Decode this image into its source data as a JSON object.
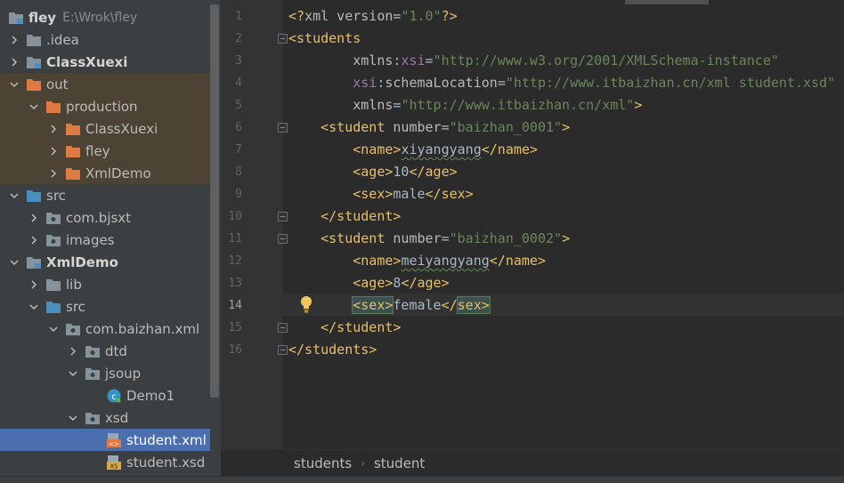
{
  "project_tree": {
    "rows": [
      {
        "label": "fley",
        "path": "E:\\Wrok\\fley",
        "level": 0,
        "arrow": "none",
        "icon": "module-folder",
        "bold": true
      },
      {
        "label": ".idea",
        "level": 0,
        "arrow": "right",
        "icon": "folder",
        "bold": false
      },
      {
        "label": "ClassXuexi",
        "level": 0,
        "arrow": "right",
        "icon": "module-folder",
        "bold": true
      },
      {
        "label": "out",
        "level": 0,
        "arrow": "down",
        "icon": "excluded-folder",
        "excluded": true
      },
      {
        "label": "production",
        "level": 1,
        "arrow": "down",
        "icon": "excluded-folder",
        "excluded": true
      },
      {
        "label": "ClassXuexi",
        "level": 2,
        "arrow": "right",
        "icon": "excluded-folder",
        "excluded": true
      },
      {
        "label": "fley",
        "level": 2,
        "arrow": "right",
        "icon": "excluded-folder",
        "excluded": true
      },
      {
        "label": "XmlDemo",
        "level": 2,
        "arrow": "right",
        "icon": "excluded-folder",
        "excluded": true
      },
      {
        "label": "src",
        "level": 0,
        "arrow": "down",
        "icon": "source-folder"
      },
      {
        "label": "com.bjsxt",
        "level": 1,
        "arrow": "right",
        "icon": "package"
      },
      {
        "label": "images",
        "level": 1,
        "arrow": "right",
        "icon": "package"
      },
      {
        "label": "XmlDemo",
        "level": 0,
        "arrow": "down",
        "icon": "module-folder",
        "bold": true
      },
      {
        "label": "lib",
        "level": 1,
        "arrow": "right",
        "icon": "folder"
      },
      {
        "label": "src",
        "level": 1,
        "arrow": "down",
        "icon": "source-folder"
      },
      {
        "label": "com.baizhan.xml",
        "level": 2,
        "arrow": "down",
        "icon": "package"
      },
      {
        "label": "dtd",
        "level": 3,
        "arrow": "right",
        "icon": "package"
      },
      {
        "label": "jsoup",
        "level": 3,
        "arrow": "down",
        "icon": "package"
      },
      {
        "label": "Demo1",
        "level": 5,
        "arrow": "none",
        "icon": "java-class"
      },
      {
        "label": "xsd",
        "level": 3,
        "arrow": "down",
        "icon": "package"
      },
      {
        "label": "student.xml",
        "level": 5,
        "arrow": "none",
        "icon": "xml-file",
        "selected": true
      },
      {
        "label": "student.xsd",
        "level": 5,
        "arrow": "none",
        "icon": "xsd-file"
      }
    ]
  },
  "editor": {
    "current_line": 14,
    "lines": [
      {
        "n": "1",
        "tokens": [
          [
            "tag",
            "<?"
          ],
          [
            "attr",
            "xml version"
          ],
          [
            "txt",
            "="
          ],
          [
            "val",
            "\"1.0\""
          ],
          [
            "tag",
            "?>"
          ]
        ]
      },
      {
        "n": "2",
        "fold": true,
        "tokens": [
          [
            "tag",
            "<students"
          ]
        ]
      },
      {
        "n": "3",
        "tokens": [
          [
            "txt",
            "        "
          ],
          [
            "attr",
            "xmlns"
          ],
          [
            "txt",
            ":"
          ],
          [
            "nsp",
            "xsi"
          ],
          [
            "txt",
            "="
          ],
          [
            "val",
            "\"http://www.w3.org/2001/XMLSchema-instance\""
          ]
        ]
      },
      {
        "n": "4",
        "tokens": [
          [
            "txt",
            "        "
          ],
          [
            "nsp",
            "xsi"
          ],
          [
            "txt",
            ":"
          ],
          [
            "attr",
            "schemaLocation"
          ],
          [
            "txt",
            "="
          ],
          [
            "val",
            "\"http://www.itbaizhan.cn/xml student.xsd\""
          ]
        ]
      },
      {
        "n": "5",
        "tokens": [
          [
            "txt",
            "        "
          ],
          [
            "attr",
            "xmlns"
          ],
          [
            "txt",
            "="
          ],
          [
            "val",
            "\"http://www.itbaizhan.cn/xml\""
          ],
          [
            "tag",
            ">"
          ]
        ]
      },
      {
        "n": "6",
        "fold": true,
        "tokens": [
          [
            "txt",
            "    "
          ],
          [
            "tag",
            "<student "
          ],
          [
            "attr",
            "number"
          ],
          [
            "txt",
            "="
          ],
          [
            "val",
            "\"baizhan_0001\""
          ],
          [
            "tag",
            ">"
          ]
        ]
      },
      {
        "n": "7",
        "tokens": [
          [
            "txt",
            "        "
          ],
          [
            "tag",
            "<name>"
          ],
          [
            "txt squig",
            "xiyangyang"
          ],
          [
            "tag",
            "</name>"
          ]
        ]
      },
      {
        "n": "8",
        "tokens": [
          [
            "txt",
            "        "
          ],
          [
            "tag",
            "<age>"
          ],
          [
            "txt",
            "10"
          ],
          [
            "tag",
            "</age>"
          ]
        ]
      },
      {
        "n": "9",
        "tokens": [
          [
            "txt",
            "        "
          ],
          [
            "tag",
            "<sex>"
          ],
          [
            "txt",
            "male"
          ],
          [
            "tag",
            "</sex>"
          ]
        ]
      },
      {
        "n": "10",
        "fold": true,
        "tokens": [
          [
            "txt",
            "    "
          ],
          [
            "tag",
            "</student>"
          ]
        ]
      },
      {
        "n": "11",
        "fold": true,
        "tokens": [
          [
            "txt",
            "    "
          ],
          [
            "tag",
            "<student "
          ],
          [
            "attr",
            "number"
          ],
          [
            "txt",
            "="
          ],
          [
            "val",
            "\"baizhan_0002\""
          ],
          [
            "tag",
            ">"
          ]
        ]
      },
      {
        "n": "12",
        "tokens": [
          [
            "txt",
            "        "
          ],
          [
            "tag",
            "<name>"
          ],
          [
            "txt squig",
            "meiyangyang"
          ],
          [
            "tag",
            "</name>"
          ]
        ]
      },
      {
        "n": "13",
        "tokens": [
          [
            "txt",
            "        "
          ],
          [
            "tag",
            "<age>"
          ],
          [
            "txt",
            "8"
          ],
          [
            "tag",
            "</age>"
          ]
        ]
      },
      {
        "n": "14",
        "tokens": [
          [
            "txt",
            "        "
          ],
          [
            "tag hl",
            "<sex>"
          ],
          [
            "txt",
            "female"
          ],
          [
            "tag",
            "</"
          ],
          [
            "tag hl",
            "sex>"
          ]
        ]
      },
      {
        "n": "15",
        "fold": true,
        "tokens": [
          [
            "txt",
            "    "
          ],
          [
            "tag",
            "</student>"
          ]
        ]
      },
      {
        "n": "16",
        "fold": true,
        "tokens": [
          [
            "tag",
            "</students>"
          ]
        ]
      }
    ]
  },
  "breadcrumbs": [
    "students",
    "student"
  ],
  "colors": {
    "tag": "#e8bf6a",
    "attribute": "#bababa",
    "namespace": "#9876aa",
    "string": "#6a8759",
    "text": "#a9b7c6",
    "selection": "#4b6eaf",
    "excluded_bg": "#4d4334"
  }
}
